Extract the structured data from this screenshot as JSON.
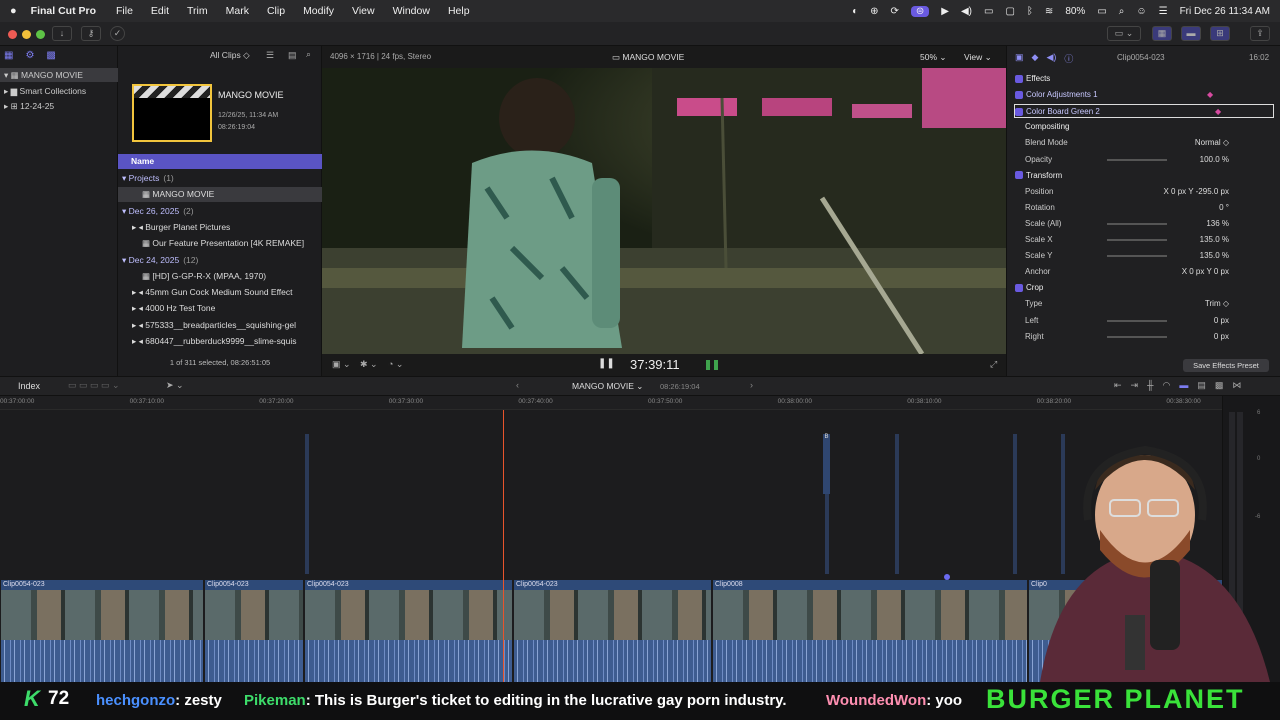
{
  "menubar": {
    "app": "Final Cut Pro",
    "items": [
      "File",
      "Edit",
      "Trim",
      "Mark",
      "Clip",
      "Modify",
      "View",
      "Window",
      "Help"
    ],
    "battery": "80%",
    "datetime": "Fri Dec 26  11:34 AM"
  },
  "library": {
    "items": [
      "MANGO MOVIE",
      "Smart Collections",
      "12-24-25"
    ]
  },
  "browser": {
    "filter": "All Clips",
    "project_title": "MANGO MOVIE",
    "project_date": "12/26/25, 11:34 AM",
    "project_duration": "08:26:19:04",
    "col_name": "Name",
    "status": "1 of 311 selected, 08:26:51:05",
    "rows": [
      {
        "kind": "group",
        "label": "Projects",
        "count": "(1)"
      },
      {
        "kind": "item",
        "label": "MANGO MOVIE",
        "selected": true
      },
      {
        "kind": "group",
        "label": "Dec 26, 2025",
        "count": "(2)"
      },
      {
        "kind": "sub",
        "label": "Burger Planet Pictures"
      },
      {
        "kind": "item",
        "label": "Our Feature Presentation [4K REMAKE]"
      },
      {
        "kind": "group",
        "label": "Dec 24, 2025",
        "count": "(12)"
      },
      {
        "kind": "item",
        "label": "[HD] G-GP-R-X (MPAA, 1970)"
      },
      {
        "kind": "sub",
        "label": "45mm Gun Cock Medium Sound Effect"
      },
      {
        "kind": "sub",
        "label": "4000 Hz Test Tone"
      },
      {
        "kind": "sub",
        "label": "575333__breadparticles__squishing-gel"
      },
      {
        "kind": "sub",
        "label": "680447__rubberduck9999__slime-squis"
      }
    ]
  },
  "viewer": {
    "format": "4096 × 1716 | 24 fps, Stereo",
    "title": "MANGO MOVIE",
    "zoom": "50%",
    "view": "View",
    "timecode": "37:39:11"
  },
  "inspector": {
    "clip": "Clip0054-023",
    "duration": "16:02",
    "rows": [
      {
        "label": "Effects",
        "kind": "section"
      },
      {
        "label": "Color Adjustments 1",
        "kind": "effect"
      },
      {
        "label": "Color Board Green 2",
        "kind": "effect-sel"
      },
      {
        "label": "Compositing",
        "kind": "header"
      },
      {
        "label": "Blend Mode",
        "value": "Normal ◇"
      },
      {
        "label": "Opacity",
        "value": "100.0  %"
      },
      {
        "label": "Transform",
        "kind": "section"
      },
      {
        "label": "Position",
        "value": "X   0 px   Y  -295.0 px"
      },
      {
        "label": "Rotation",
        "value": "0 °"
      },
      {
        "label": "Scale (All)",
        "value": "136  %"
      },
      {
        "label": "Scale X",
        "value": "135.0  %"
      },
      {
        "label": "Scale Y",
        "value": "135.0  %"
      },
      {
        "label": "Anchor",
        "value": "X   0 px   Y   0 px"
      },
      {
        "label": "Crop",
        "kind": "section"
      },
      {
        "label": "Type",
        "value": "Trim ◇"
      },
      {
        "label": "Left",
        "value": "0 px"
      },
      {
        "label": "Right",
        "value": "0 px"
      }
    ],
    "save_preset": "Save Effects Preset"
  },
  "timeline": {
    "index": "Index",
    "project": "MANGO MOVIE",
    "duration": "08:26:19:04",
    "ruler": [
      "00:37:00:00",
      "00:37:10:00",
      "00:37:20:00",
      "00:37:30:00",
      "00:37:40:00",
      "00:37:50:00",
      "00:38:00:00",
      "00:38:10:00",
      "00:38:20:00",
      "00:38:30:00"
    ],
    "clips": [
      "Clip0054-023",
      "Clip0054-023",
      "Clip0054-023",
      "Clip0054-023",
      "Clip0008",
      "Clip0"
    ],
    "marker_b": "B"
  },
  "meters": {
    "labels": [
      "6",
      "0",
      "-6"
    ]
  },
  "chat": {
    "count": "72",
    "messages": [
      {
        "user": "hechgonzo",
        "text": ": zesty",
        "color": "#4a90ff"
      },
      {
        "user": "Pikeman",
        "text": ": This is Burger's ticket to editing in the lucrative gay porn industry.",
        "color": "#3ddc6a"
      },
      {
        "user": "WoundedWon",
        "text": ": yoo",
        "color": "#ff8fb1"
      }
    ],
    "brand": "BURGER PLANET"
  },
  "colors": {
    "accent": "#6a5ae0",
    "playhead": "#e8542c",
    "chat_green": "#3ddc6a",
    "brand": "#3ae23a"
  }
}
